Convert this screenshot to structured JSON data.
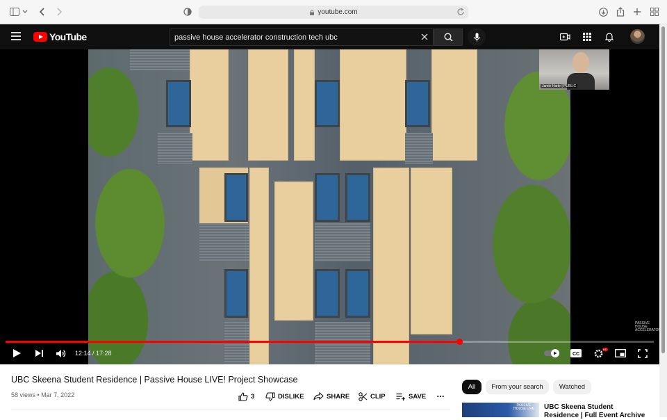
{
  "browser": {
    "url": "youtube.com"
  },
  "header": {
    "logo_text": "YouTube",
    "search_query": "passive house accelerator construction tech ubc"
  },
  "player": {
    "time_display": "12:14 / 17:28",
    "progress": 0.7,
    "webcam_label": "Jamie Harte | PUBLIC",
    "watermark": "PASSIVE HOUSE ACCELERATOR",
    "hd_badge": "HD"
  },
  "video": {
    "title": "UBC Skeena Student Residence | Passive House LIVE! Project Showcase",
    "meta": "58 views • Mar 7, 2022",
    "like_count": "3",
    "dislike_label": "DISLIKE",
    "share_label": "SHARE",
    "clip_label": "CLIP",
    "save_label": "SAVE"
  },
  "chips": [
    "All",
    "From your search",
    "Watched"
  ],
  "recommendation": {
    "title": "UBC Skeena Student Residence | Full Event Archive",
    "thumb_badge": "PASSIVE HOUSE LIVE"
  },
  "colors": {
    "accent": "#ff0000",
    "header_bg": "#0f0f0f"
  }
}
